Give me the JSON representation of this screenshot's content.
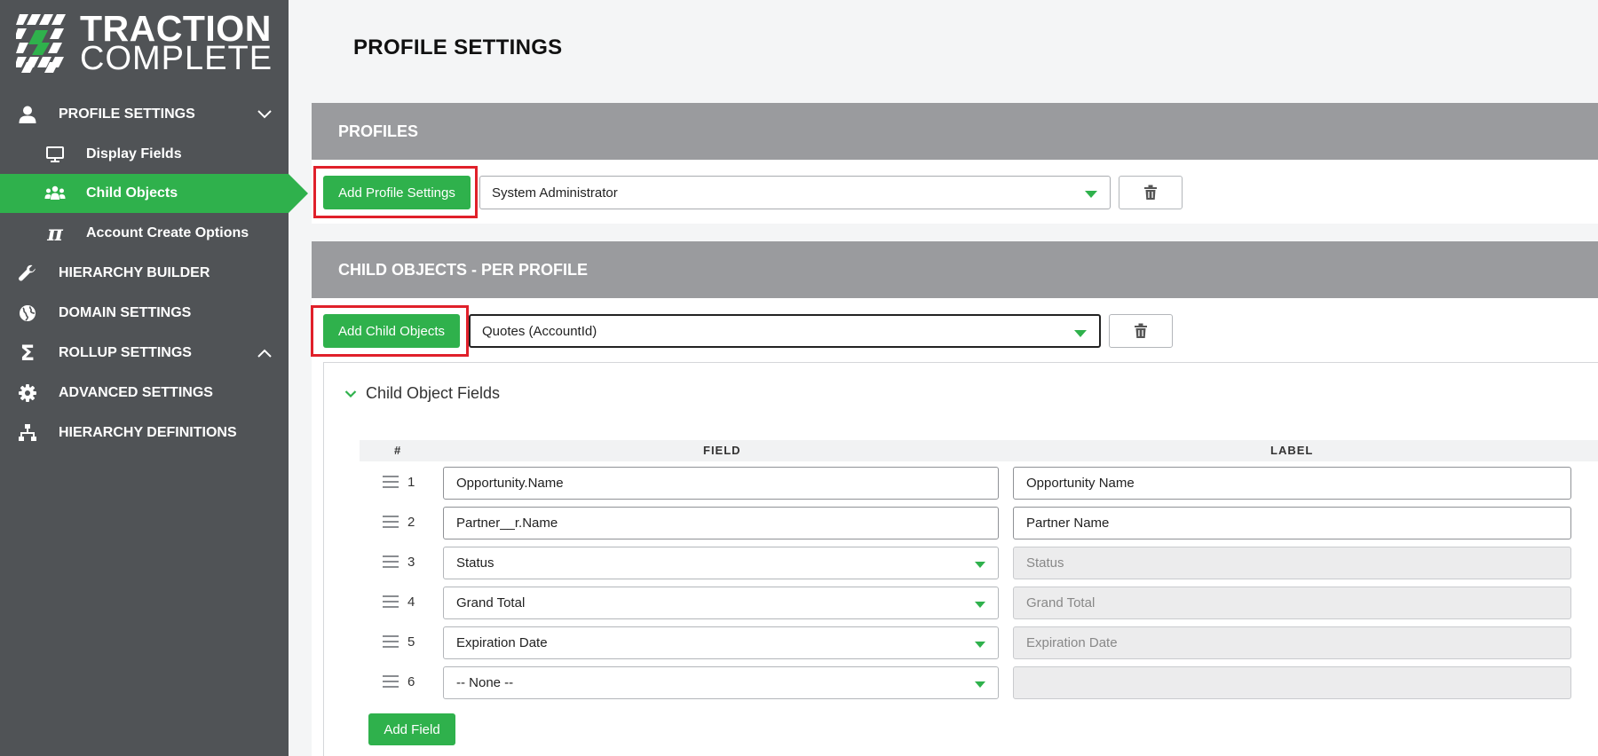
{
  "brand": {
    "line1": "TRACTION",
    "line2": "COMPLETE"
  },
  "sidebar": {
    "items": [
      {
        "label": "PROFILE SETTINGS",
        "icon": "user-icon",
        "expanded": true
      },
      {
        "label": "Display Fields",
        "icon": "monitor-icon"
      },
      {
        "label": "Child Objects",
        "icon": "group-icon",
        "active": true
      },
      {
        "label": "Account Create Options",
        "icon": "pi-icon"
      },
      {
        "label": "HIERARCHY BUILDER",
        "icon": "wrench-icon"
      },
      {
        "label": "DOMAIN SETTINGS",
        "icon": "globe-icon"
      },
      {
        "label": "ROLLUP SETTINGS",
        "icon": "sigma-icon",
        "expanded": false
      },
      {
        "label": "ADVANCED SETTINGS",
        "icon": "gear-icon"
      },
      {
        "label": "HIERARCHY DEFINITIONS",
        "icon": "sitemap-icon"
      }
    ]
  },
  "page": {
    "title": "PROFILE SETTINGS"
  },
  "profiles": {
    "header": "PROFILES",
    "add_button": "Add Profile Settings",
    "selected_profile": "System Administrator"
  },
  "child_objects": {
    "header": "CHILD OBJECTS - PER PROFILE",
    "add_button": "Add Child Objects",
    "selected_object": "Quotes (AccountId)",
    "panel_title": "Child Object Fields",
    "columns": {
      "num": "#",
      "field": "FIELD",
      "label": "LABEL"
    },
    "rows": [
      {
        "num": "1",
        "field": "Opportunity.Name",
        "label": "Opportunity Name",
        "field_type": "text",
        "label_disabled": false
      },
      {
        "num": "2",
        "field": "Partner__r.Name",
        "label": "Partner Name",
        "field_type": "text",
        "label_disabled": false
      },
      {
        "num": "3",
        "field": "Status",
        "label": "Status",
        "field_type": "select",
        "label_disabled": true
      },
      {
        "num": "4",
        "field": "Grand Total",
        "label": "Grand Total",
        "field_type": "select",
        "label_disabled": true
      },
      {
        "num": "5",
        "field": "Expiration Date",
        "label": "Expiration Date",
        "field_type": "select",
        "label_disabled": true
      },
      {
        "num": "6",
        "field": "-- None --",
        "label": "",
        "field_type": "select",
        "label_disabled": true
      }
    ],
    "add_field_button": "Add Field"
  },
  "colors": {
    "sidebar": "#505356",
    "accent": "#2fb14c",
    "section_header": "#9a9b9e",
    "highlight": "#e0202a"
  }
}
